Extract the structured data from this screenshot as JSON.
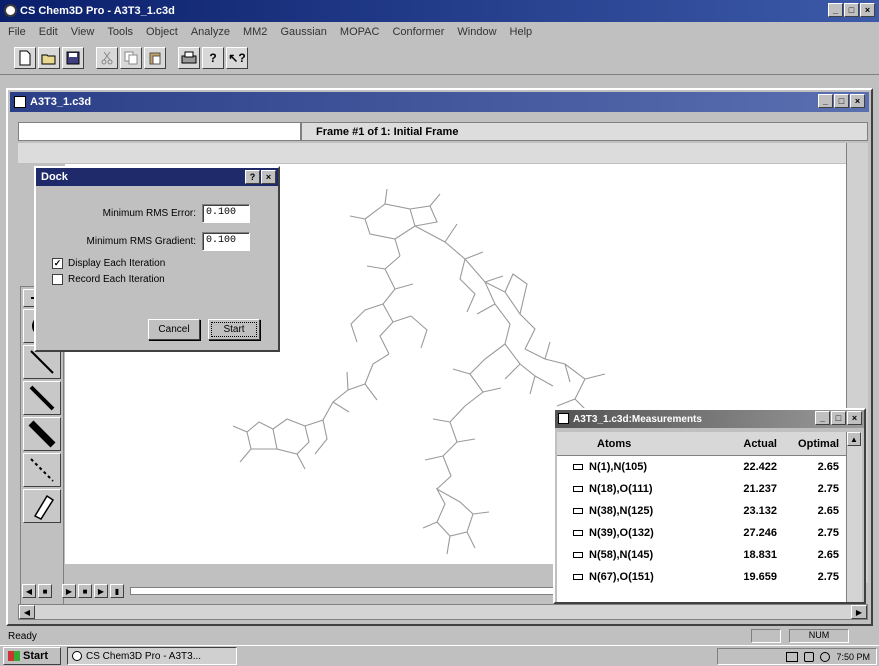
{
  "app": {
    "title": "CS Chem3D Pro - A3T3_1.c3d"
  },
  "menu": [
    "File",
    "Edit",
    "View",
    "Tools",
    "Object",
    "Analyze",
    "MM2",
    "Gaussian",
    "MOPAC",
    "Conformer",
    "Window",
    "Help"
  ],
  "toolbar": {
    "buttons": [
      "new-icon",
      "open-icon",
      "save-icon",
      "cut-icon",
      "copy-icon",
      "paste-icon",
      "print-icon",
      "help-icon",
      "context-help-icon"
    ]
  },
  "document": {
    "title": "A3T3_1.c3d",
    "frame_label": "Frame #1 of 1: Initial Frame"
  },
  "palette": {
    "tools": [
      "rotate-icon",
      "single-bond-icon",
      "double-bond-icon",
      "triple-bond-icon",
      "dummy-bond-icon",
      "eraser-icon"
    ]
  },
  "dock_dialog": {
    "title": "Dock",
    "min_rms_error_label": "Minimum RMS Error:",
    "min_rms_error_value": "0.100",
    "min_rms_gradient_label": "Minimum RMS Gradient:",
    "min_rms_gradient_value": "0.100",
    "display_each_iteration_label": "Display Each Iteration",
    "display_each_iteration_checked": true,
    "record_each_iteration_label": "Record Each Iteration",
    "record_each_iteration_checked": false,
    "cancel_label": "Cancel",
    "start_label": "Start"
  },
  "measurements": {
    "title": "A3T3_1.c3d:Measurements",
    "columns": [
      "Atoms",
      "Actual",
      "Optimal"
    ],
    "rows": [
      {
        "atoms": "N(1),N(105)",
        "actual": "22.422",
        "optimal": "2.65"
      },
      {
        "atoms": "N(18),O(111)",
        "actual": "21.237",
        "optimal": "2.75"
      },
      {
        "atoms": "N(38),N(125)",
        "actual": "23.132",
        "optimal": "2.65"
      },
      {
        "atoms": "N(39),O(132)",
        "actual": "27.246",
        "optimal": "2.75"
      },
      {
        "atoms": "N(58),N(145)",
        "actual": "18.831",
        "optimal": "2.65"
      },
      {
        "atoms": "N(67),O(151)",
        "actual": "19.659",
        "optimal": "2.75"
      }
    ]
  },
  "status": {
    "text": "Ready",
    "num": "NUM"
  },
  "taskbar": {
    "start_label": "Start",
    "task_label": "CS Chem3D Pro - A3T3...",
    "clock": "7:50 PM"
  }
}
